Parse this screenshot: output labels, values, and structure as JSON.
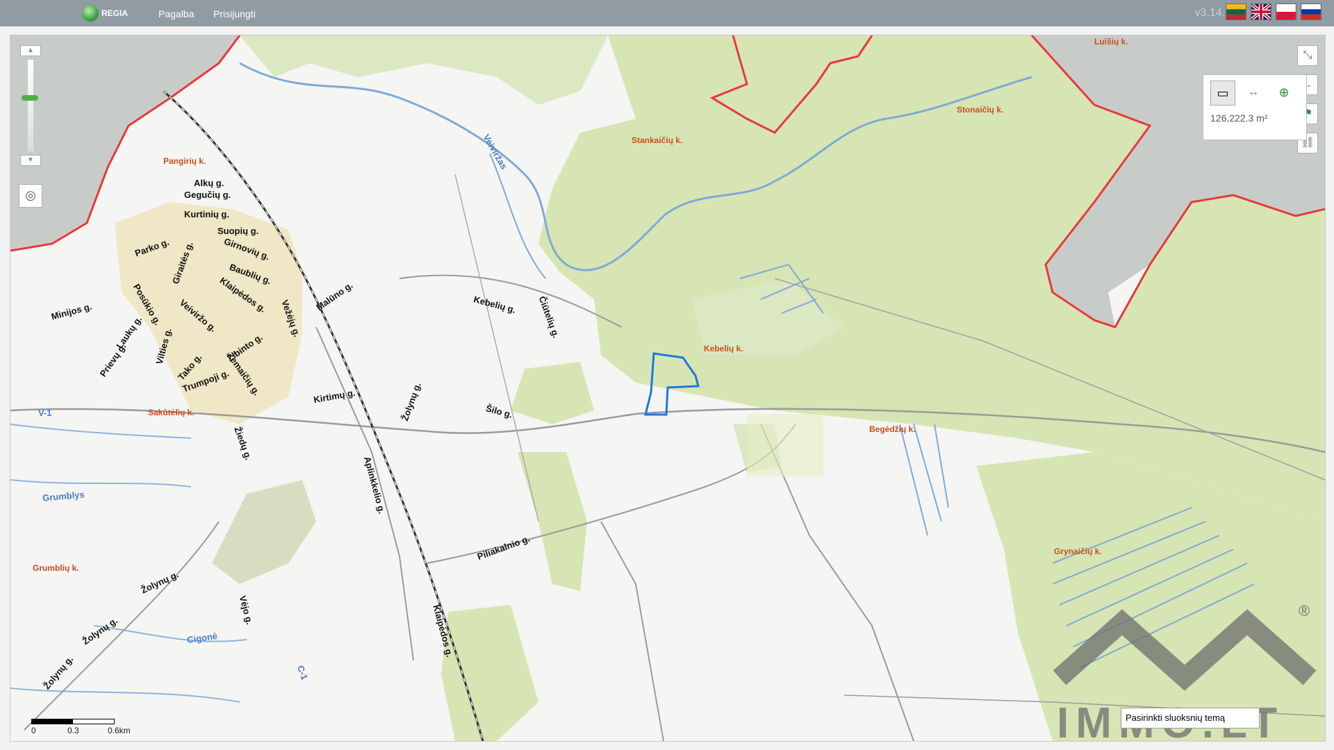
{
  "app": {
    "name": "REGIA",
    "version": "v3.14.3"
  },
  "nav": {
    "help": "Pagalba",
    "login": "Prisijungti"
  },
  "flags": [
    {
      "name": "lithuania-flag-icon",
      "colors": [
        "#fdb913",
        "#006a44",
        "#c1272d"
      ]
    },
    {
      "name": "uk-flag-icon",
      "colors": [
        "#012169",
        "#ffffff",
        "#c8102e"
      ]
    },
    {
      "name": "poland-flag-icon",
      "colors": [
        "#ffffff",
        "#dc143c"
      ]
    },
    {
      "name": "russia-flag-icon",
      "colors": [
        "#ffffff",
        "#0039a6",
        "#d52b1e"
      ]
    }
  ],
  "measure": {
    "area": "126,222.3 m²"
  },
  "scale": {
    "ticks": [
      "0",
      "0.3",
      "0.6km"
    ]
  },
  "theme": {
    "placeholder": "Pasirinkti sluoksnių temą"
  },
  "watermark": {
    "text": "IMMO.LT"
  },
  "colors": {
    "forest": "#d6e5b3",
    "boundary": "#e8383d",
    "parcel": "#1f77e0",
    "water": "#7fa9d8",
    "road": "#9a9a9a",
    "village": "#c8501c"
  },
  "labels": {
    "roads": [
      "Alkų g.",
      "Gegučių g.",
      "Kurtinių g.",
      "Suopių g.",
      "Girnovių g.",
      "Parko g.",
      "Giraitės g.",
      "Baublių g.",
      "Klaipėdos g.",
      "Malūno g.",
      "Vežėjų g.",
      "Minijos g.",
      "Posūkio g.",
      "Veiviržo g.",
      "Laukų g.",
      "Vilties g.",
      "Prievų g.",
      "Žibinto g.",
      "Tako g.",
      "Žemaičių g.",
      "Trumpoji g.",
      "Kebelių g.",
      "Čiūtelių g.",
      "Kirtimų g.",
      "Žolynų g.",
      "Šilo g.",
      "Aplinkkelio g.",
      "Žiedų g.",
      "Piliakalnio g.",
      "Vėjo g.",
      "Klaipėdos g.",
      "Žolynų g.",
      "Žolynų g.",
      "Žolynų g."
    ],
    "villages": [
      "Pangirių k.",
      "Stankaičių k.",
      "Stonaičių k.",
      "Kebelių k.",
      "Sakūtėlių k.",
      "Begėdžių k.",
      "Grumblių k.",
      "Grynaičių k.",
      "Luišių k."
    ],
    "water": [
      "Veiviržas",
      "Grumblys",
      "Cigonė",
      "V-1",
      "C-1"
    ]
  }
}
